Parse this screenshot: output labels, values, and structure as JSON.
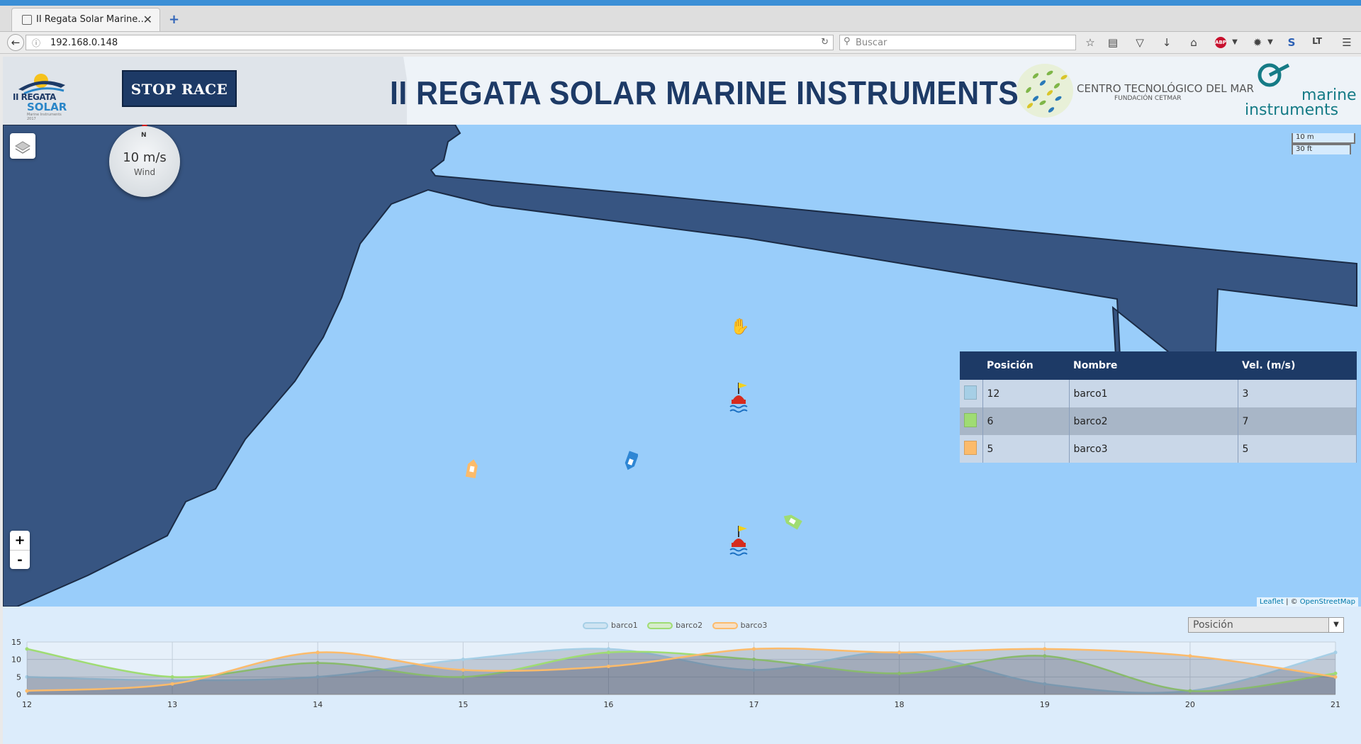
{
  "browser": {
    "tab_title": "II Regata Solar Marine…",
    "tab_close": "✕",
    "new_tab": "+",
    "url": "192.168.0.148",
    "search_placeholder": "Buscar"
  },
  "header": {
    "logo_line1": "II REGATA",
    "logo_line2": "SOLAR",
    "logo_line3": "Marine Instruments 2017",
    "stop_button": "STOP RACE",
    "title": "II REGATA SOLAR MARINE INSTRUMENTS",
    "sponsor1_line1": "CENTRO TECNOLÓGICO DEL MAR",
    "sponsor1_line2": "FUNDACIÓN CETMAR",
    "sponsor2_line1": "marine",
    "sponsor2_line2": "instruments"
  },
  "map": {
    "wind_speed": "10 m/s",
    "wind_label": "Wind",
    "north": "N",
    "scale_metric": "10 m",
    "scale_imperial": "30 ft",
    "zoom_in": "+",
    "zoom_out": "-",
    "attrib_leaflet": "Leaflet",
    "attrib_sep": " | © ",
    "attrib_osm": "OpenStreetMap"
  },
  "ranking": {
    "headers": [
      "",
      "Posición",
      "Nombre",
      "Vel. (m/s)"
    ],
    "rows": [
      {
        "color": "#a6cfe6",
        "pos": "12",
        "name": "barco1",
        "vel": "3"
      },
      {
        "color": "#9fdc73",
        "pos": "6",
        "name": "barco2",
        "vel": "7"
      },
      {
        "color": "#fcbb6b",
        "pos": "5",
        "name": "barco3",
        "vel": "5"
      }
    ]
  },
  "chart_selector": "Posición",
  "chart_data": {
    "type": "area",
    "x": [
      12,
      13,
      14,
      15,
      16,
      17,
      18,
      19,
      20,
      21
    ],
    "ylim": [
      0,
      15
    ],
    "yticks": [
      0,
      5,
      10,
      15
    ],
    "series": [
      {
        "name": "barco1",
        "color": "#a6cfe6",
        "values": [
          5,
          4,
          5,
          10,
          13,
          7,
          12,
          3,
          1,
          12
        ]
      },
      {
        "name": "barco2",
        "color": "#9fdc73",
        "values": [
          13,
          5,
          9,
          5,
          12,
          10,
          6,
          11,
          1,
          6
        ]
      },
      {
        "name": "barco3",
        "color": "#fcbb6b",
        "values": [
          1,
          3,
          12,
          7,
          8,
          13,
          12,
          13,
          11,
          5
        ]
      }
    ],
    "grid": true,
    "legend_position": "top-center"
  },
  "icons": {
    "back": "back-arrow-icon",
    "bookmark": "star-icon",
    "home": "home-icon",
    "menu": "hamburger-menu-icon"
  }
}
